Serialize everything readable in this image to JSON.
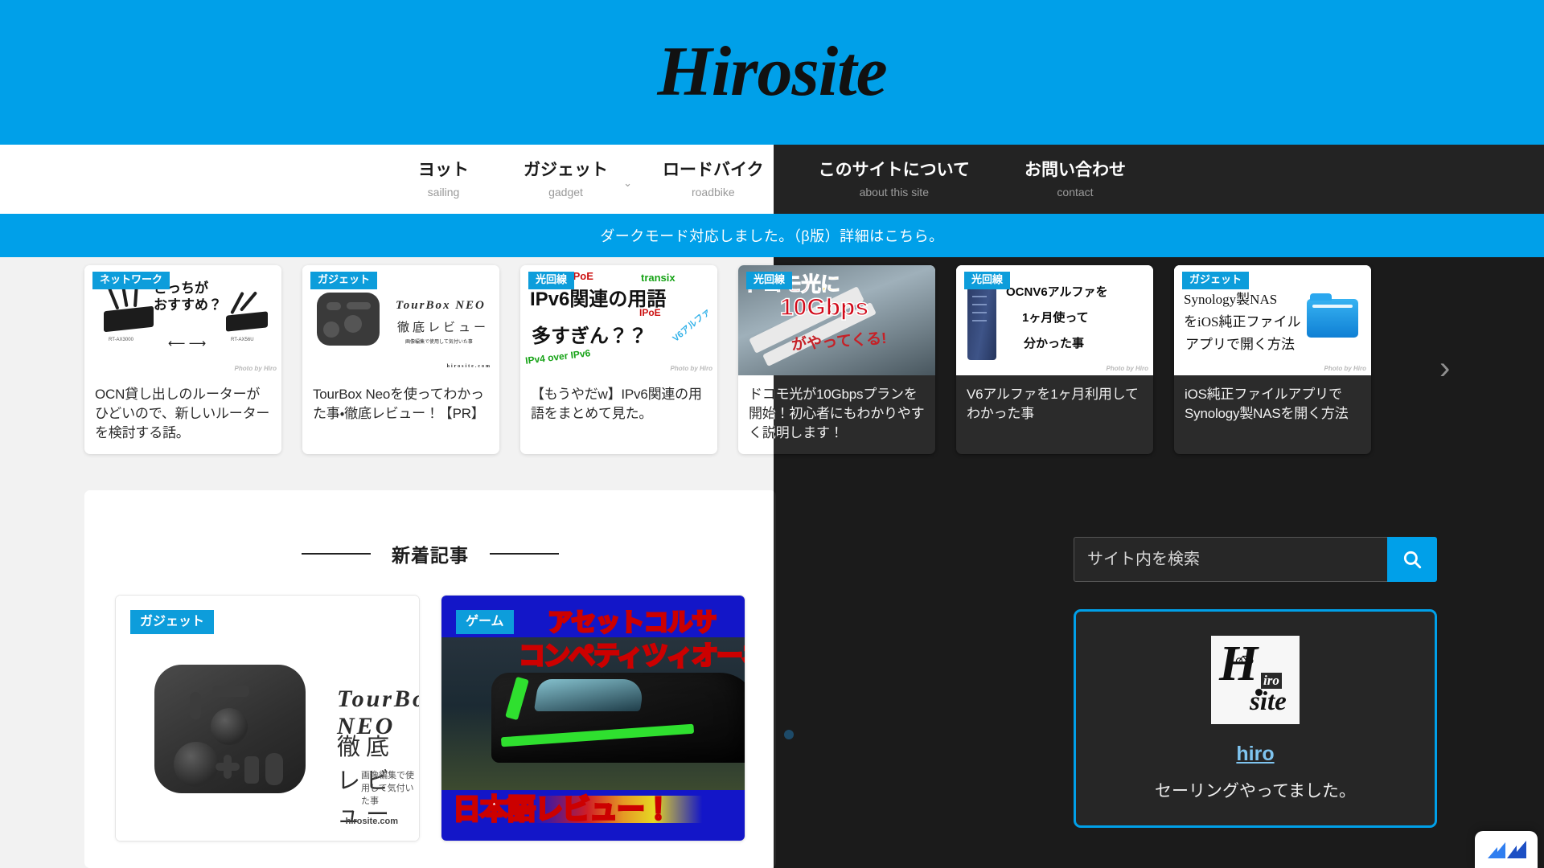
{
  "site": {
    "logo_text": "Hirosite",
    "brand_color": "#00a0e9",
    "dark_bg": "#1b1b1b",
    "badge_color": "#0d9ddb"
  },
  "nav": {
    "items": [
      {
        "ja": "ヨット",
        "en": "sailing",
        "has_caret": false
      },
      {
        "ja": "ガジェット",
        "en": "gadget",
        "has_caret": true
      },
      {
        "ja": "ロードバイク",
        "en": "roadbike",
        "has_caret": false
      },
      {
        "ja": "このサイトについて",
        "en": "about this site",
        "has_caret": false
      },
      {
        "ja": "お問い合わせ",
        "en": "contact",
        "has_caret": false
      }
    ],
    "caret_icon": "⌄"
  },
  "notice": {
    "text": "ダークモード対応しました。（β版）詳細はこちら。"
  },
  "carousel": {
    "prev_icon": "‹",
    "next_icon": "›",
    "dots": 2,
    "cards": [
      {
        "badge": "ネットワーク",
        "title": "OCN貸し出しのルーターがひどいので、新しいルーターを検討する話。",
        "thumb_text": {
          "l1": "どっちが",
          "l2": "おすすめ？",
          "left_model": "RT-AX3000",
          "right_model": "RT-AX56U",
          "arrows": "⟵ ⟶"
        },
        "credit": "Photo by Hiro"
      },
      {
        "badge": "ガジェット",
        "title": "TourBox Neoを使ってわかった事・徹底レビュー！【PR】",
        "thumb_text": {
          "l1": "TourBox NEO",
          "l2": "徹底レビュー",
          "l3": "画像編集で使用して気付いた事",
          "domain": "hirosite.com"
        },
        "credit": ""
      },
      {
        "badge": "光回線",
        "title": "【もうやだw】IPv6関連の用語をまとめて見た。",
        "thumb_text": {
          "l1": "IPv6関連の用語",
          "l2": "多すぎん？？",
          "t_ipoe": "IPoE",
          "t_transix": "transix",
          "t_ipoe2": "IPoE",
          "t_v6alpha": "V6アルファ",
          "t_ipv4": "IPv4 over IPv6"
        },
        "credit": "Photo by Hiro"
      },
      {
        "badge": "光回線",
        "title": "ドコモ光が10Gbpsプランを開始！初心者にもわかりやすく説明します！",
        "thumb_text": {
          "l1": "ドコモ光",
          "l1b": "に",
          "l2": "10Gbps",
          "l3": "がやってくる!"
        },
        "credit": ""
      },
      {
        "badge": "光回線",
        "title": "V6アルファを1ヶ月利用してわかった事",
        "thumb_text": {
          "l1": "OCNV6アルファを",
          "l2": "1ヶ月使って",
          "l3": "分かった事"
        },
        "credit": "Photo by Hiro"
      },
      {
        "badge": "ガジェット",
        "title": "iOS純正ファイルアプリでSynology製NASを開く方法",
        "thumb_text": {
          "l1": "Synology製NAS",
          "l2": "をiOS純正ファイル",
          "l3": "アプリで開く方法"
        },
        "credit": "Photo by Hiro"
      }
    ]
  },
  "main": {
    "section_title": "新着記事",
    "posts": [
      {
        "badge": "ガジェット",
        "thumb_text": {
          "title": "TourBox NEO",
          "subtitle": "徹底 レビュー",
          "caption": "画像編集で使用して気付いた事",
          "domain": "hirosite.com"
        }
      },
      {
        "badge": "ゲーム",
        "thumb_text": {
          "l1": "アセットコルサ",
          "l2": "コンペティツィオーネ",
          "l3": "日本語レビュー！"
        }
      }
    ]
  },
  "sidebar": {
    "search": {
      "placeholder": "サイト内を検索",
      "value": "",
      "icon": "search-icon"
    },
    "profile": {
      "avatar_h": "H",
      "avatar_iro": "iro",
      "avatar_site": "site",
      "name": "hiro",
      "bio": "セーリングやってました。"
    }
  },
  "share_widget": {
    "icon": "share-arrow-icon"
  }
}
